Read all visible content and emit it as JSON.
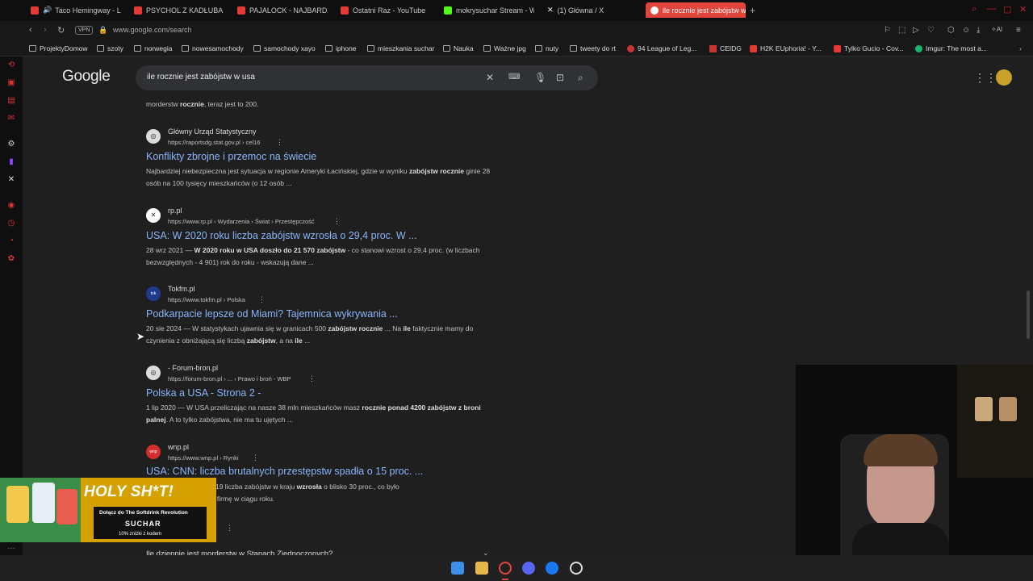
{
  "tabs": [
    {
      "label": "Taco Hemingway - LE",
      "color": "#e53935"
    },
    {
      "label": "PSYCHOL Z KADŁUBA ZO",
      "color": "#e53935"
    },
    {
      "label": "PAJALOCK - NAJBARDZI",
      "color": "#e53935"
    },
    {
      "label": "Ostatni Raz - YouTube",
      "color": "#e53935"
    },
    {
      "label": "mokrysuchar Stream - Wa",
      "color": "#53fc18"
    },
    {
      "label": "(1) Główna / X",
      "color": "#ffffff"
    },
    {
      "label": "ile rocznie jest zabójstw w",
      "color": "#ffffff"
    }
  ],
  "addressbar": {
    "vpn": "VPN",
    "url": "www.google.com/search"
  },
  "bookmarks": [
    "ProjektyDomow",
    "szoty",
    "norwegia",
    "nowesamochody",
    "samochody xayo",
    "iphone",
    "mieszkania suchar",
    "Nauka",
    "Ważne jpg",
    "nuty",
    "tweety do rt",
    "94 League of Leg...",
    "CEIDG",
    "H2K EUphoria! - Y...",
    "Tylko Gucio - Cov...",
    "Imgur: The most a..."
  ],
  "search": {
    "logo": "Google",
    "query": "ile rocznie jest zabójstw w usa"
  },
  "top_snippet": {
    "pre": "morderstw ",
    "bold": "rocznie",
    "post": ", teraz jest to 200."
  },
  "results": [
    {
      "source": "Główny Urząd Statystyczny",
      "url": "https://raportsdg.stat.gov.pl › cel16",
      "title": "Konflikty zbrojne i przemoc na świecie",
      "snippet_html": "Najbardziej niebezpieczna jest sytuacja w regionie Ameryki Łacińskiej, gdzie w wyniku <b>zabójstw rocznie</b> ginie 28 osób na 100 tysięcy mieszkańców (o 12 osób ..."
    },
    {
      "source": "rp.pl",
      "url": "https://www.rp.pl › Wydarzenia › Świat › Przestępczość",
      "title": "USA: W 2020 roku liczba zabójstw wzrosła o 29,4 proc. W ...",
      "snippet_html": "28 wrz 2021 — <b>W 2020 roku w USA doszło do 21 570 zabójstw</b> - co stanowi wzrost o 29,4 proc. (w liczbach bezwzględnych - 4 901) rok do roku - wskazują dane ..."
    },
    {
      "source": "Tokfm.pl",
      "url": "https://www.tokfm.pl › Polska",
      "title": "Podkarpacie lepsze od Miami? Tajemnica wykrywania ...",
      "snippet_html": "20 sie 2024 — W statystykach ujawnia się w granicach 500 <b>zabójstw rocznie</b> ... Na <b>ile</b> faktycznie mamy do czynienia z obniżającą się liczbą <b>zabójstw</b>, a na <b>ile</b> ..."
    },
    {
      "source": "- Forum-bron.pl",
      "url": "https://forum-bron.pl › ... › Prawo i broń - WBP",
      "title": "Polska a USA - Strona 2 -",
      "snippet_html": "1 lip 2020 — W USA przeliczając na nasze 38 mln mieszkańców masz <b>rocznie ponad 4200 zabójstw z broni palnej</b>. A to tylko zabójstwa, nie ma tu ujętych ..."
    },
    {
      "source": "wnp.pl",
      "url": "https://www.wnp.pl › Rynki",
      "title": "USA: CNN: liczba brutalnych przestępstw spadła o 15 proc. ...",
      "snippet_html": "...kcie pandemii Covid-19 liczba zabójstw w kraju <b>wzrosła</b> o blisko 30 proc., co było<br>... odnotowanym przez firmę w ciągu roku."
    }
  ],
  "people_also_ask": "Ile dziennie jest morderstw w Stanach Zjednoczonych?",
  "ad": {
    "headline": "HOLY SH*T!",
    "line": "Dołącz do The Softdrink Revolution",
    "brand": "SUCHAR",
    "disclaimer": "10% zniżki z kodem"
  },
  "colors": {
    "accent": "#e0443a",
    "link": "#8ab4f8",
    "page_bg": "#1f1f1f"
  }
}
